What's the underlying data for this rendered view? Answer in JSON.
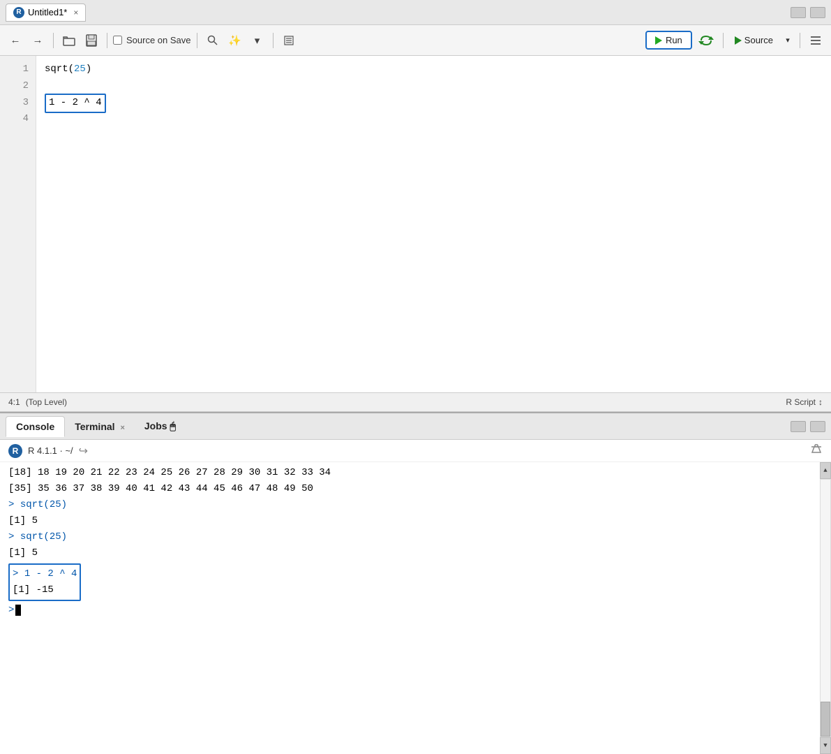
{
  "title_bar": {
    "tab_label": "Untitled1*",
    "close_label": "×",
    "r_icon": "R"
  },
  "toolbar": {
    "back_icon": "←",
    "forward_icon": "→",
    "open_icon": "📁",
    "save_icon": "💾",
    "source_on_save_label": "Source on Save",
    "search_icon": "🔍",
    "magic_wand_icon": "✨",
    "dropdown_icon": "▾",
    "pages_icon": "☰",
    "run_label": "Run",
    "rerun_icon": "↺",
    "source_label": "Source",
    "hamburger_icon": "≡"
  },
  "editor": {
    "lines": [
      "1",
      "2",
      "3",
      "4"
    ],
    "line1_code": "sqrt(25)",
    "line3_code": "1 - 2 ^ 4",
    "line3_highlighted": true
  },
  "status_bar": {
    "position": "4:1",
    "scope": "(Top Level)",
    "file_type": "R Script"
  },
  "console": {
    "tabs": [
      {
        "label": "Console",
        "active": true
      },
      {
        "label": "Terminal",
        "active": false,
        "closable": true
      },
      {
        "label": "Jobs",
        "active": false
      }
    ],
    "r_version": "R 4.1.1",
    "working_dir": "~/",
    "output_lines": [
      {
        "type": "result",
        "text": "[18]  18  19  20  21  22  23  24  25  26  27  28  29  30  31  32  33  34"
      },
      {
        "type": "result",
        "text": "[35]  35  36  37  38  39  40  41  42  43  44  45  46  47  48  49  50"
      },
      {
        "type": "cmd",
        "text": "> sqrt(25)"
      },
      {
        "type": "result",
        "text": "[1] 5"
      },
      {
        "type": "cmd",
        "text": "> sqrt(25)"
      },
      {
        "type": "result",
        "text": "[1] 5"
      }
    ],
    "highlighted_cmd": "> 1 - 2 ^ 4",
    "highlighted_result": "[1] -15",
    "prompt": ">"
  }
}
